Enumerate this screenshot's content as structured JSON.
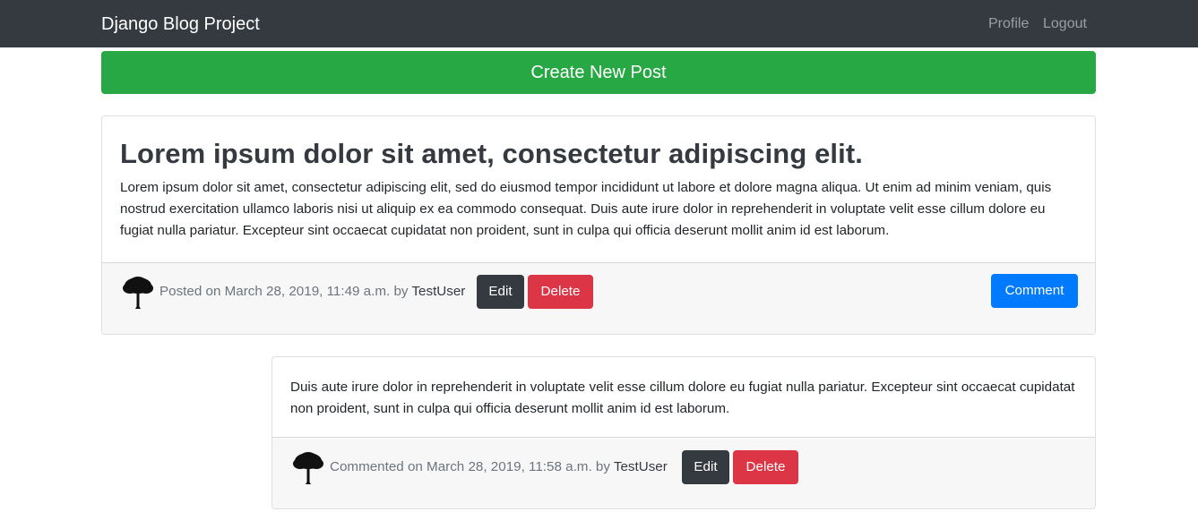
{
  "navbar": {
    "brand": "Django Blog Project",
    "links": [
      "Profile",
      "Logout"
    ]
  },
  "create_button": "Create New Post",
  "post": {
    "title": "Lorem ipsum dolor sit amet, consectetur adipiscing elit.",
    "body": "Lorem ipsum dolor sit amet, consectetur adipiscing elit, sed do eiusmod tempor incididunt ut labore et dolore magna aliqua. Ut enim ad minim veniam, quis nostrud exercitation ullamco laboris nisi ut aliquip ex ea commodo consequat. Duis aute irure dolor in reprehenderit in voluptate velit esse cillum dolore eu fugiat nulla pariatur. Excepteur sint occaecat cupidatat non proident, sunt in culpa qui officia deserunt mollit anim id est laborum.",
    "meta_prefix": "Posted on March 28, 2019, 11:49 a.m. by",
    "author": "TestUser",
    "edit_label": "Edit",
    "delete_label": "Delete",
    "comment_label": "Comment",
    "avatar_icon": "tree-avatar-icon"
  },
  "comment": {
    "body": "Duis aute irure dolor in reprehenderit in voluptate velit esse cillum dolore eu fugiat nulla pariatur. Excepteur sint occaecat cupidatat non proident, sunt in culpa qui officia deserunt mollit anim id est laborum.",
    "meta_prefix": "Commented on March 28, 2019, 11:58 a.m. by",
    "author": "TestUser",
    "edit_label": "Edit",
    "delete_label": "Delete",
    "avatar_icon": "tree-avatar-icon"
  },
  "colors": {
    "navbar": "#343a40",
    "success": "#28a745",
    "danger": "#dc3545",
    "primary": "#007bff",
    "dark": "#343a40"
  }
}
